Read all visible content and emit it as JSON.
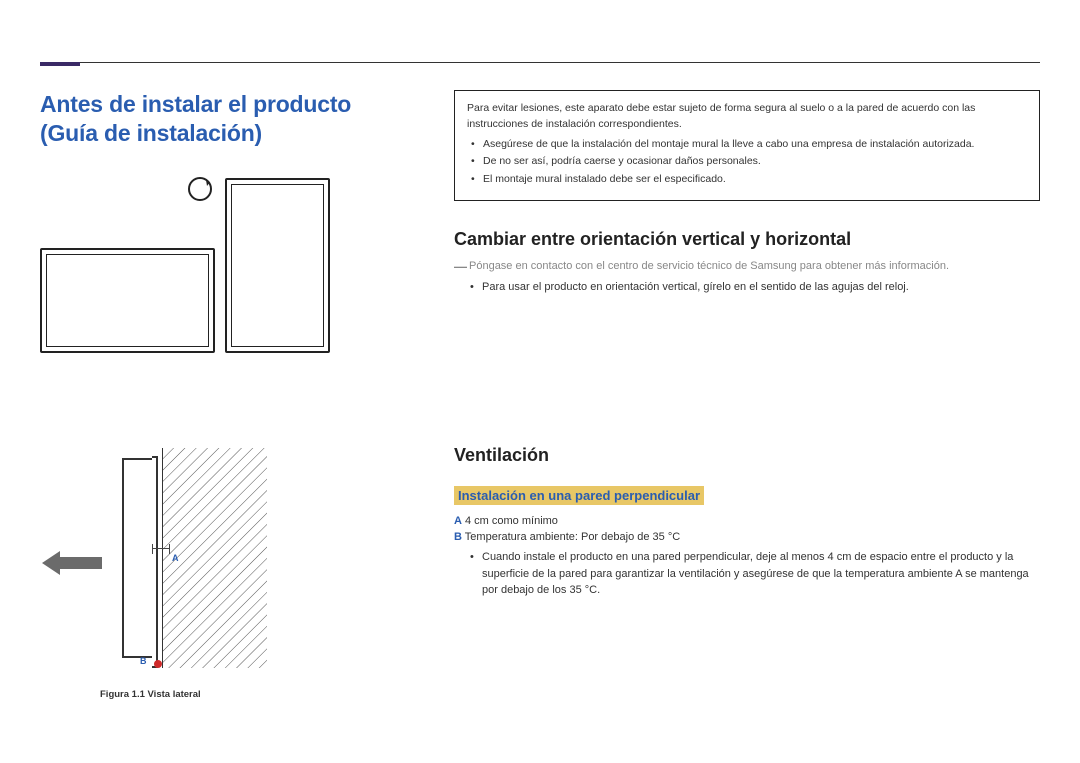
{
  "title_line1": "Antes de instalar el producto",
  "title_line2": "(Guía de instalación)",
  "warning": {
    "intro": "Para evitar lesiones, este aparato debe estar sujeto de forma segura al suelo o a la pared de acuerdo con las instrucciones de instalación correspondientes.",
    "b1": "Asegúrese de que la instalación del montaje mural la lleve a cabo una empresa de instalación autorizada.",
    "b2": "De no ser así, podría caerse y ocasionar daños personales.",
    "b3": "El montaje mural instalado debe ser el especificado."
  },
  "orientation": {
    "heading": "Cambiar entre orientación vertical y horizontal",
    "note": "Póngase en contacto con el centro de servicio técnico de Samsung para obtener más información.",
    "b1": "Para usar el producto en orientación vertical, gírelo en el sentido de las agujas del reloj."
  },
  "ventilation": {
    "heading": "Ventilación",
    "subheading": "Instalación en una pared perpendicular",
    "specA_key": "A",
    "specA_val": " 4 cm como mínimo",
    "specB_key": "B",
    "specB_val": " Temperatura ambiente: Por debajo de 35 °C",
    "b1": "Cuando instale el producto en una pared perpendicular, deje al menos 4 cm de espacio entre el producto y la superficie de la pared para garantizar la ventilación y asegúrese de que la temperatura ambiente A se mantenga por debajo de los 35 °C."
  },
  "figure": {
    "labelA": "A",
    "labelB": "B",
    "caption": "Figura 1.1 Vista lateral"
  }
}
